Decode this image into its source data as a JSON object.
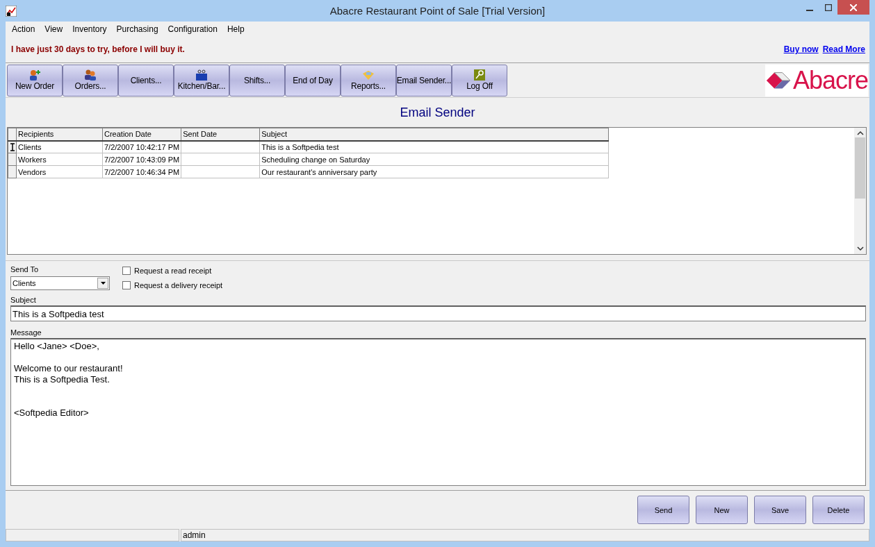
{
  "window": {
    "title": "Abacre Restaurant Point of Sale [Trial Version]"
  },
  "menu": [
    "Action",
    "View",
    "Inventory",
    "Purchasing",
    "Configuration",
    "Help"
  ],
  "banner": {
    "text": "I have just 30 days to try, before I will buy it.",
    "links": [
      "Buy now",
      "Read More"
    ]
  },
  "toolbar": [
    {
      "label": "New Order",
      "kind": "new-order"
    },
    {
      "label": "Orders...",
      "kind": "orders"
    },
    {
      "label": "Clients...",
      "kind": "none"
    },
    {
      "label": "Kitchen/Bar...",
      "kind": "kitchen"
    },
    {
      "label": "Shifts...",
      "kind": "none"
    },
    {
      "label": "End of Day",
      "kind": "none"
    },
    {
      "label": "Reports...",
      "kind": "reports"
    },
    {
      "label": "Email Sender...",
      "kind": "none"
    },
    {
      "label": "Log Off",
      "kind": "logoff"
    }
  ],
  "logo": {
    "text": "Abacre"
  },
  "heading": "Email Sender",
  "table": {
    "columns": [
      "Recipients",
      "Creation Date",
      "Sent Date",
      "Subject"
    ],
    "rows": [
      {
        "cells": [
          "Clients",
          "7/2/2007 10:42:17 PM",
          "",
          "This is a Softpedia test"
        ],
        "selected": true
      },
      {
        "cells": [
          "Workers",
          "7/2/2007 10:43:09 PM",
          "",
          "Scheduling change on Saturday"
        ],
        "selected": false
      },
      {
        "cells": [
          "Vendors",
          "7/2/2007 10:46:34 PM",
          "",
          "Our restaurant's anniversary party"
        ],
        "selected": false
      }
    ]
  },
  "form": {
    "send_to": {
      "label": "Send To",
      "value": "Clients"
    },
    "options": [
      {
        "label": "Request a read receipt",
        "checked": false
      },
      {
        "label": "Request a delivery receipt",
        "checked": false
      }
    ],
    "subject": {
      "label": "Subject",
      "value": "This is a Softpedia test"
    },
    "message": {
      "label": "Message",
      "value": "Hello <Jane> <Doe>,\n\nWelcome to our restaurant!\nThis is a Softpedia Test.\n\n\n<Softpedia Editor>"
    }
  },
  "actions": [
    "Send",
    "New",
    "Save",
    "Delete"
  ],
  "status_bar": [
    "admin"
  ]
}
